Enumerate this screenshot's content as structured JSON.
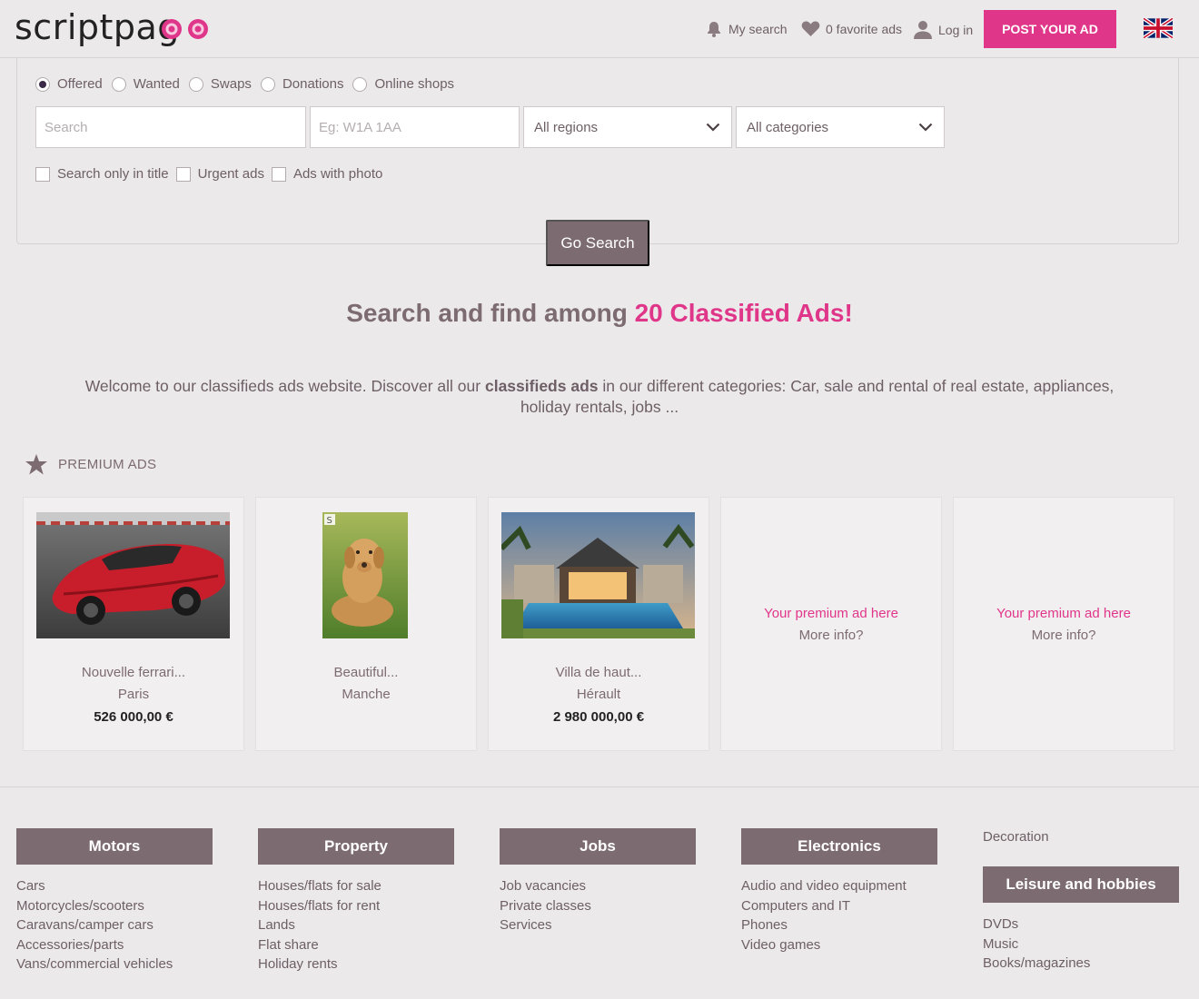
{
  "header": {
    "logo_text": "scriptpag",
    "my_search": "My search",
    "favorites": "0 favorite ads",
    "login": "Log in",
    "post_ad": "POST YOUR AD",
    "language_icon": "uk-flag-icon"
  },
  "search": {
    "ad_types": [
      {
        "label": "Offered",
        "checked": true
      },
      {
        "label": "Wanted",
        "checked": false
      },
      {
        "label": "Swaps",
        "checked": false
      },
      {
        "label": "Donations",
        "checked": false
      },
      {
        "label": "Online shops",
        "checked": false
      }
    ],
    "keyword_placeholder": "Search",
    "postcode_placeholder": "Eg: W1A 1AA",
    "region_selected": "All regions",
    "category_selected": "All categories",
    "options": [
      {
        "label": "Search only in title",
        "checked": false
      },
      {
        "label": "Urgent ads",
        "checked": false
      },
      {
        "label": "Ads with photo",
        "checked": false
      }
    ],
    "go_button": "Go Search"
  },
  "headline": {
    "prefix": "Search and find among ",
    "highlight": "20 Classified Ads!"
  },
  "welcome": {
    "part1": "Welcome to our classifieds ads website. Discover all our ",
    "bold": "classifieds ads",
    "part2": " in our different categories: Car, sale and rental of real estate, appliances, holiday rentals, jobs ..."
  },
  "premium": {
    "heading": "PREMIUM ADS",
    "cards": [
      {
        "title": "Nouvelle ferrari...",
        "location": "Paris",
        "price": "526 000,00 €"
      },
      {
        "title": "Beautiful...",
        "location": "Manche",
        "price": ""
      },
      {
        "title": "Villa de haut...",
        "location": "Hérault",
        "price": "2 980 000,00 €"
      }
    ],
    "placeholder": {
      "promo": "Your premium ad here",
      "more": "More info?"
    }
  },
  "categories": {
    "motors": {
      "title": "Motors",
      "items": [
        "Cars",
        "Motorcycles/scooters",
        "Caravans/camper cars",
        "Accessories/parts",
        "Vans/commercial vehicles"
      ]
    },
    "property": {
      "title": "Property",
      "items": [
        "Houses/flats for sale",
        "Houses/flats for rent",
        "Lands",
        "Flat share",
        "Holiday rents"
      ]
    },
    "jobs": {
      "title": "Jobs",
      "items": [
        "Job vacancies",
        "Private classes",
        "Services"
      ]
    },
    "electronics": {
      "title": "Electronics",
      "items": [
        "Audio and video equipment",
        "Computers and IT",
        "Phones",
        "Video games"
      ]
    },
    "decoration": {
      "title": "Decoration"
    },
    "leisure": {
      "title": "Leisure and hobbies",
      "items": [
        "DVDs",
        "Music",
        "Books/magazines"
      ]
    }
  },
  "colors": {
    "accent": "#e0368a",
    "brand": "#7d6b72",
    "background": "#ebe9ea"
  }
}
